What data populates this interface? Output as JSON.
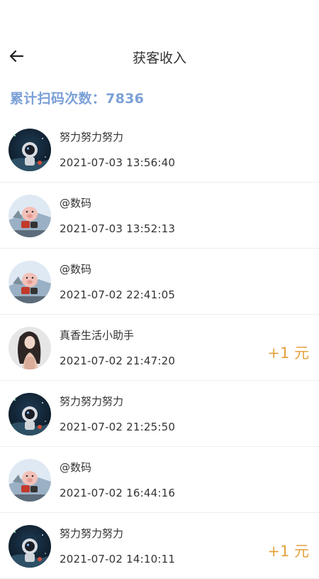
{
  "header": {
    "title": "获客收入"
  },
  "summary": {
    "label": "累计扫码次数：",
    "value": "7836"
  },
  "records": [
    {
      "name": "努力努力努力",
      "time": "2021-07-03 13:56:40",
      "amount": "",
      "avatar": "astronaut-avatar"
    },
    {
      "name": "@数码",
      "time": "2021-07-03 13:52:13",
      "amount": "",
      "avatar": "pig-avatar"
    },
    {
      "name": "@数码",
      "time": "2021-07-02 22:41:05",
      "amount": "",
      "avatar": "pig-avatar"
    },
    {
      "name": "真香生活小助手",
      "time": "2021-07-02 21:47:20",
      "amount": "+1 元",
      "avatar": "girl-avatar"
    },
    {
      "name": "努力努力努力",
      "time": "2021-07-02 21:25:50",
      "amount": "",
      "avatar": "astronaut-avatar"
    },
    {
      "name": "@数码",
      "time": "2021-07-02 16:44:16",
      "amount": "",
      "avatar": "pig-avatar"
    },
    {
      "name": "努力努力努力",
      "time": "2021-07-02 14:10:11",
      "amount": "+1 元",
      "avatar": "astronaut-avatar"
    }
  ]
}
